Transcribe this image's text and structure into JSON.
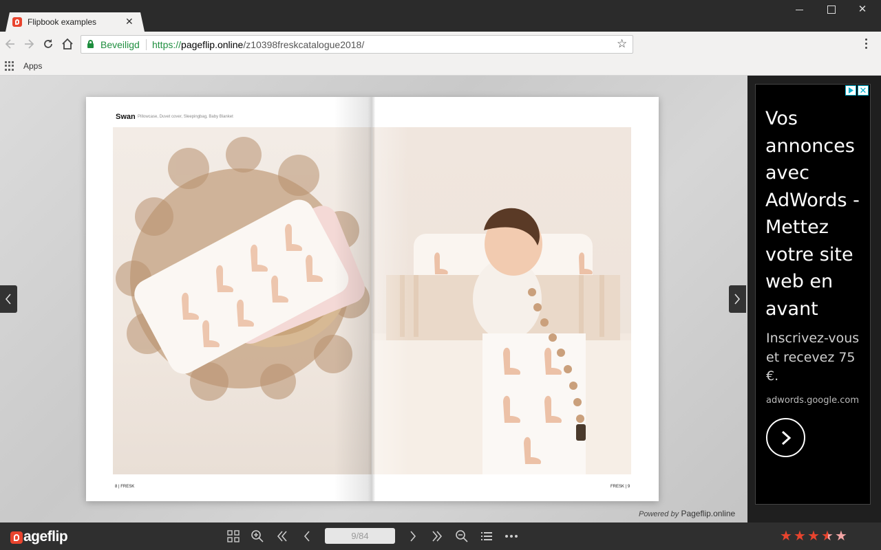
{
  "browser": {
    "tab_title": "Flipbook examples",
    "tab_close": "✕",
    "secure_label": "Beveiligd",
    "url_scheme": "https://",
    "url_host": "pageflip.online",
    "url_path": "/z10398freskcatalogue2018/",
    "bookmark_apps": "Apps",
    "window_close": "✕",
    "star": "☆"
  },
  "flipbook": {
    "page_title": "Swan",
    "page_subtitle": "Pillowcase, Duvet cover, Sleepingbag, Baby Blanket",
    "folio_left": "8 | FRESK",
    "folio_right": "FRESK | 9",
    "powered_prefix": "Powered by",
    "powered_brand": "Pageflip.online"
  },
  "ad": {
    "headline": "Vos annonces avec AdWords - Mettez votre site web en avant",
    "subtext": "Inscrivez-vous et recevez 75 €.",
    "domain": "adwords.google.com",
    "close": "✕"
  },
  "bottom_bar": {
    "logo_text": "ageflip",
    "page_indicator": "9/84",
    "rating": 3.5,
    "rating_max": 5,
    "star_color": "#e8442e"
  }
}
